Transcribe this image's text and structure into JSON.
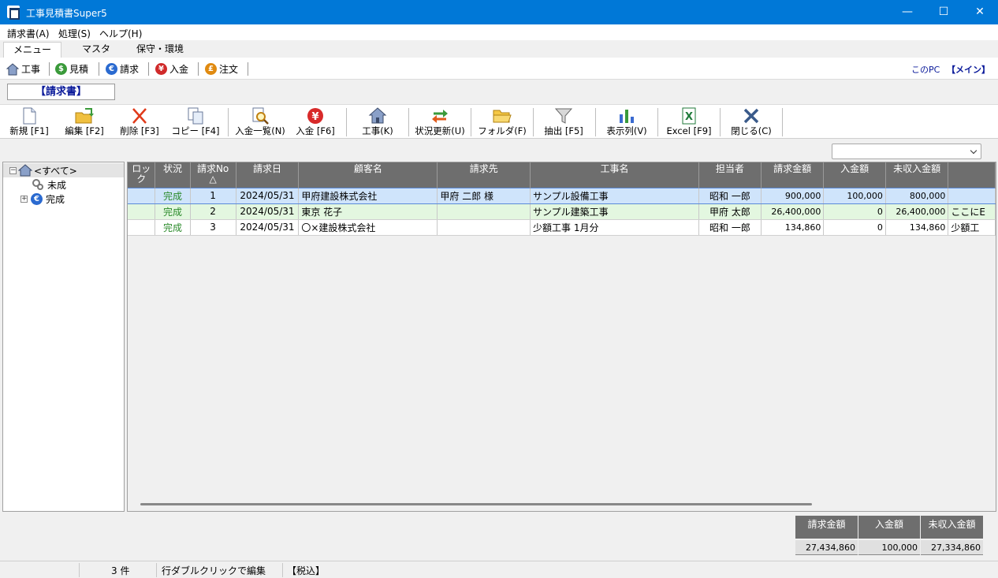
{
  "window": {
    "title": "工事見積書Super5"
  },
  "menu": [
    "請求書(A)",
    "処理(S)",
    "ヘルプ(H)"
  ],
  "tabs": [
    "メニュー",
    "マスタ",
    "保守・環境"
  ],
  "nav": {
    "items": [
      "工事",
      "見積",
      "請求",
      "入金",
      "注文"
    ],
    "location": "このPC",
    "database": "【メイン】"
  },
  "section_title": "【請求書】",
  "toolbar": [
    "新規 [F1]",
    "編集 [F2]",
    "削除 [F3]",
    "コピー [F4]",
    "入金一覧(N)",
    "入金 [F6]",
    "工事(K)",
    "状況更新(U)",
    "フォルダ(F)",
    "抽出 [F5]",
    "表示列(V)",
    "Excel [F9]",
    "閉じる(C)"
  ],
  "filter_combo": {
    "value": ""
  },
  "tree": {
    "root": "<すべて>",
    "children": [
      "未成",
      "完成"
    ]
  },
  "grid": {
    "columns": [
      "ロック",
      "状況",
      "請求No",
      "請求日",
      "顧客名",
      "請求先",
      "工事名",
      "担当者",
      "請求金額",
      "入金額",
      "未収入金額",
      ""
    ],
    "sort_mark": "△",
    "rows": [
      {
        "lock": "",
        "status": "完成",
        "no": "1",
        "date": "2024/05/31",
        "customer": "甲府建設株式会社",
        "billto": "甲府 二郎 様",
        "project": "サンプル設備工事",
        "staff": "昭和 一郎",
        "amount": "900,000",
        "paid": "100,000",
        "unpaid": "800,000",
        "extra": ""
      },
      {
        "lock": "",
        "status": "完成",
        "no": "2",
        "date": "2024/05/31",
        "customer": "東京 花子",
        "billto": "",
        "project": "サンプル建築工事",
        "staff": "甲府 太郎",
        "amount": "26,400,000",
        "paid": "0",
        "unpaid": "26,400,000",
        "extra": "ここにE"
      },
      {
        "lock": "",
        "status": "完成",
        "no": "3",
        "date": "2024/05/31",
        "customer": "〇×建設株式会社",
        "billto": "",
        "project": "少額工事 1月分",
        "staff": "昭和 一郎",
        "amount": "134,860",
        "paid": "0",
        "unpaid": "134,860",
        "extra": "少額工"
      }
    ]
  },
  "totals": {
    "headers": [
      "請求金額",
      "入金額",
      "未収入金額"
    ],
    "values": [
      "27,434,860",
      "100,000",
      "27,334,860"
    ]
  },
  "status": {
    "count": "3 件",
    "hint": "行ダブルクリックで編集",
    "tax": "【税込】"
  }
}
